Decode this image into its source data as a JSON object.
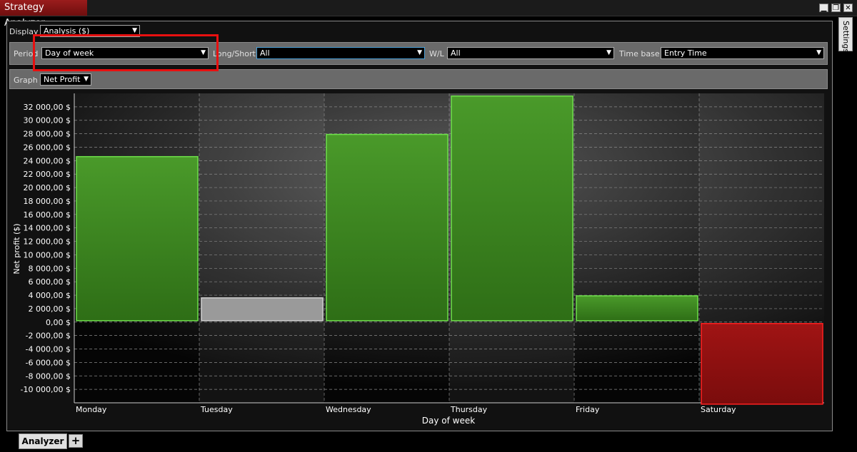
{
  "window": {
    "title": "Strategy Analyzer",
    "controls": [
      "▁",
      "❐",
      "✕"
    ]
  },
  "settings_tab": "Settings",
  "display": {
    "label": "Display",
    "value": "Analysis ($)"
  },
  "filters": {
    "period_label": "Period",
    "period_value": "Day of week",
    "longshort_label": "Long/Short",
    "longshort_value": "All",
    "wl_label": "W/L",
    "wl_value": "All",
    "timebase_label": "Time base",
    "timebase_value": "Entry Time"
  },
  "graph": {
    "label": "Graph",
    "value": "Net Profit"
  },
  "bottom_tabs": {
    "analyzer": "Analyzer",
    "add": "+"
  },
  "chart_data": {
    "type": "bar",
    "xlabel": "Day of week",
    "ylabel": "Net profit ($)",
    "categories": [
      "Monday",
      "Tuesday",
      "Wednesday",
      "Thursday",
      "Friday",
      "Saturday"
    ],
    "values": [
      24600,
      3600,
      27900,
      33600,
      3900,
      -12200
    ],
    "ylim": [
      -12000,
      34000
    ],
    "yticks": [
      "32 000,00 $",
      "30 000,00 $",
      "28 000,00 $",
      "26 000,00 $",
      "24 000,00 $",
      "22 000,00 $",
      "20 000,00 $",
      "18 000,00 $",
      "16 000,00 $",
      "14 000,00 $",
      "12 000,00 $",
      "10 000,00 $",
      "8 000,00 $",
      "6 000,00 $",
      "4 000,00 $",
      "2 000,00 $",
      "0,00 $",
      "-2 000,00 $",
      "-4 000,00 $",
      "-6 000,00 $",
      "-8 000,00 $",
      "-10 000,00 $"
    ],
    "ytick_values": [
      32000,
      30000,
      28000,
      26000,
      24000,
      22000,
      20000,
      18000,
      16000,
      14000,
      12000,
      10000,
      8000,
      6000,
      4000,
      2000,
      0,
      -2000,
      -4000,
      -6000,
      -8000,
      -10000
    ],
    "colors": {
      "positive": "#3a8a1e",
      "positive_border": "#6ee04a",
      "highlight": "#9a9a9a",
      "negative": "#8e1010",
      "negative_border": "#ff2020"
    },
    "highlighted_category": "Tuesday",
    "grid": true
  }
}
